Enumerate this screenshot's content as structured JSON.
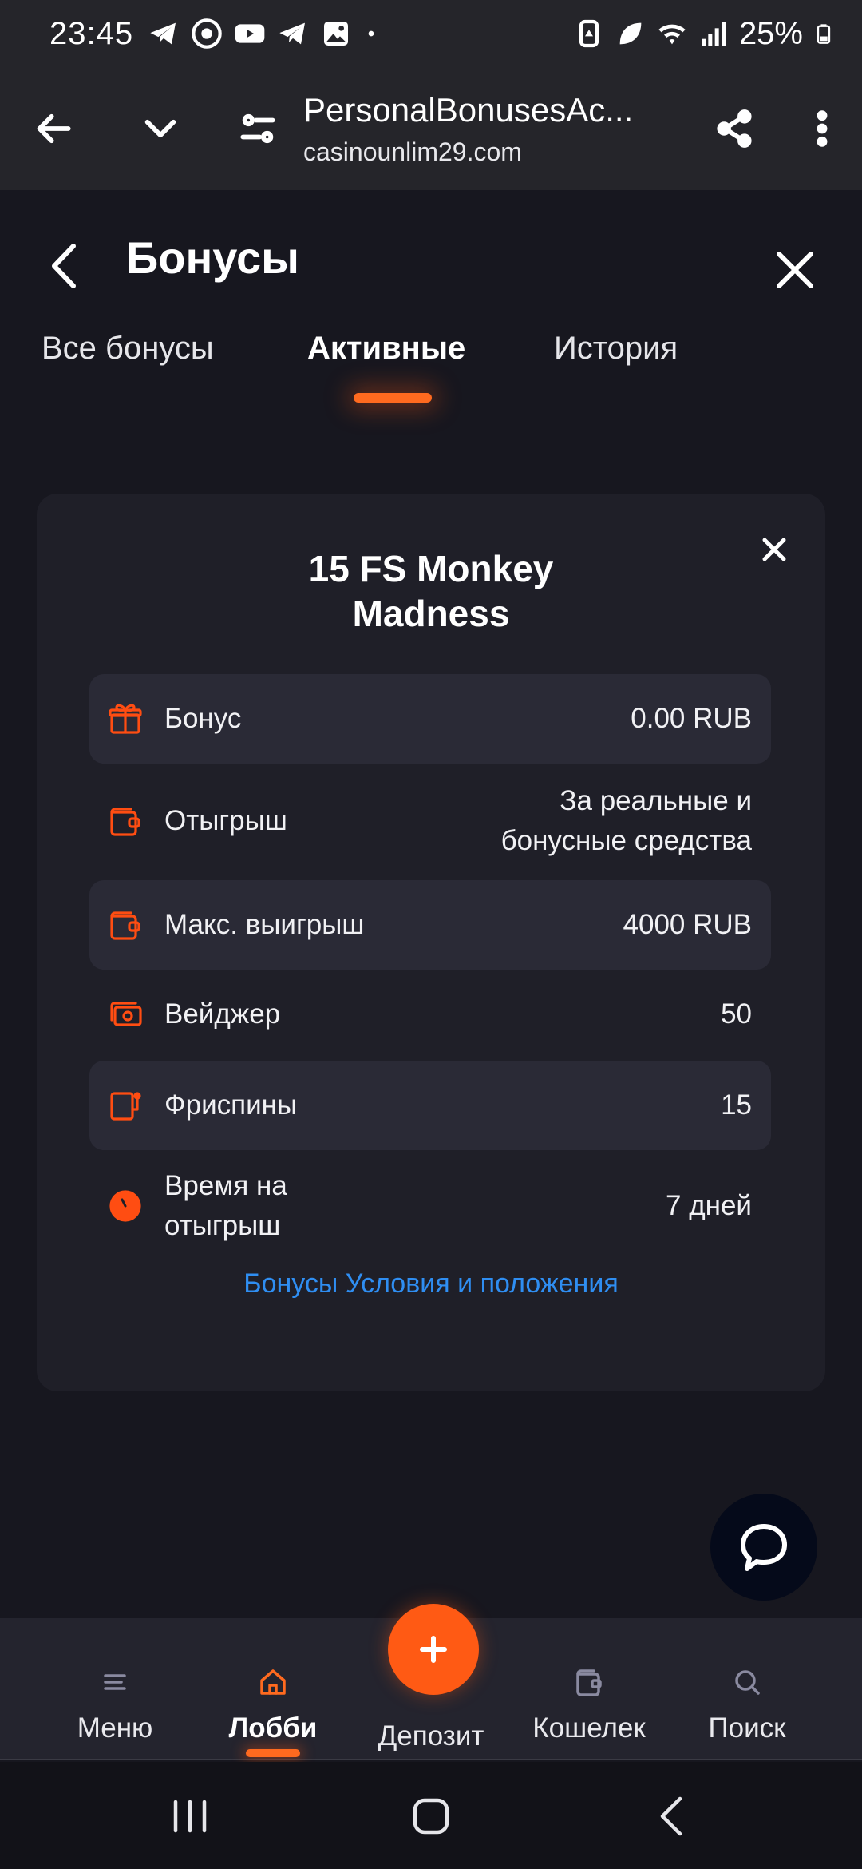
{
  "status_bar": {
    "time": "23:45",
    "battery": "25%",
    "left_icons": [
      "telegram-icon",
      "chrome-icon",
      "youtube-icon",
      "telegram-icon",
      "gallery-icon",
      "dot-icon"
    ],
    "right_icons": [
      "battery-saver-icon",
      "leaf-icon",
      "wifi-icon",
      "signal-icon",
      "battery-icon"
    ]
  },
  "browser": {
    "page_title": "PersonalBonusesAc...",
    "domain": "casinounlim29.com"
  },
  "header": {
    "title": "Бонусы"
  },
  "tabs": [
    {
      "label": "Все бонусы",
      "active": false
    },
    {
      "label": "Активные",
      "active": true
    },
    {
      "label": "История",
      "active": false
    }
  ],
  "card": {
    "title_line1": "15 FS Monkey",
    "title_line2": "Madness",
    "rows": [
      {
        "label": "Бонус",
        "value": "0.00 RUB",
        "icon": "gift-icon"
      },
      {
        "label": "Отыгрыш",
        "value_line1": "За реальные и",
        "value_line2": "бонусные средства",
        "icon": "wallet-icon"
      },
      {
        "label": "Макс. выигрыш",
        "value": "4000 RUB",
        "icon": "wallet-icon"
      },
      {
        "label": "Вейджер",
        "value": "50",
        "icon": "cash-icon"
      },
      {
        "label": "Фриспины",
        "value": "15",
        "icon": "slot-machine-icon"
      },
      {
        "label_line1": "Время на",
        "label_line2": "отыгрыш",
        "value": "7 дней",
        "icon": "clock-icon"
      }
    ],
    "terms_link": "Бонусы Условия и положения"
  },
  "bottom_nav": {
    "menu": "Меню",
    "lobby": "Лобби",
    "deposit": "Депозит",
    "wallet": "Кошелек",
    "search": "Поиск",
    "active": "lobby"
  },
  "colors": {
    "accent": "#ff5a14",
    "link": "#2f8ef2",
    "background": "#17171f",
    "card": "#1f1f28",
    "row_shaded": "#2a2a36"
  }
}
